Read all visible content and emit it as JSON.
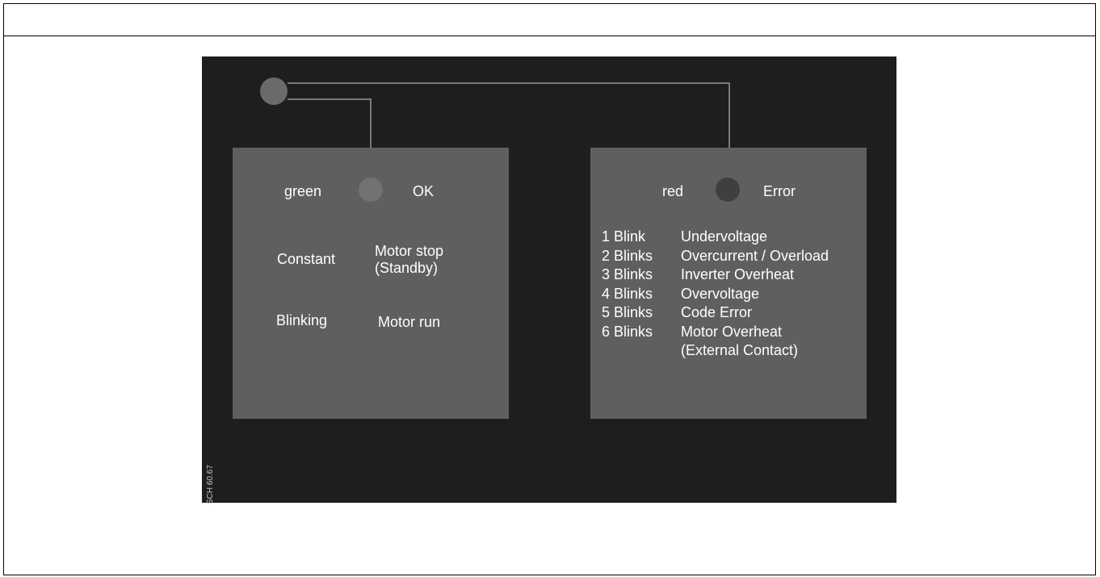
{
  "figure": {
    "background_color": "#1e1e1e",
    "panel_color": "#5f5f5f",
    "wire_color": "#7a7a7a",
    "reference_code": "SCH 60.67"
  },
  "ok_panel": {
    "color_label": "green",
    "status_label": "OK",
    "states": [
      {
        "mode": "Constant",
        "meaning_line1": "Motor stop",
        "meaning_line2": "(Standby)"
      },
      {
        "mode": "Blinking",
        "meaning_line1": "Motor run"
      }
    ]
  },
  "error_panel": {
    "color_label": "red",
    "status_label": "Error",
    "codes": [
      {
        "count": "1 Blink",
        "meaning": "Undervoltage"
      },
      {
        "count": "2 Blinks",
        "meaning": "Overcurrent / Overload"
      },
      {
        "count": "3 Blinks",
        "meaning": "Inverter Overheat"
      },
      {
        "count": "4 Blinks",
        "meaning": "Overvoltage"
      },
      {
        "count": "5 Blinks",
        "meaning": "Code Error"
      },
      {
        "count": "6 Blinks",
        "meaning": "Motor Overheat"
      },
      {
        "count": "",
        "meaning": "(External Contact)"
      }
    ]
  }
}
